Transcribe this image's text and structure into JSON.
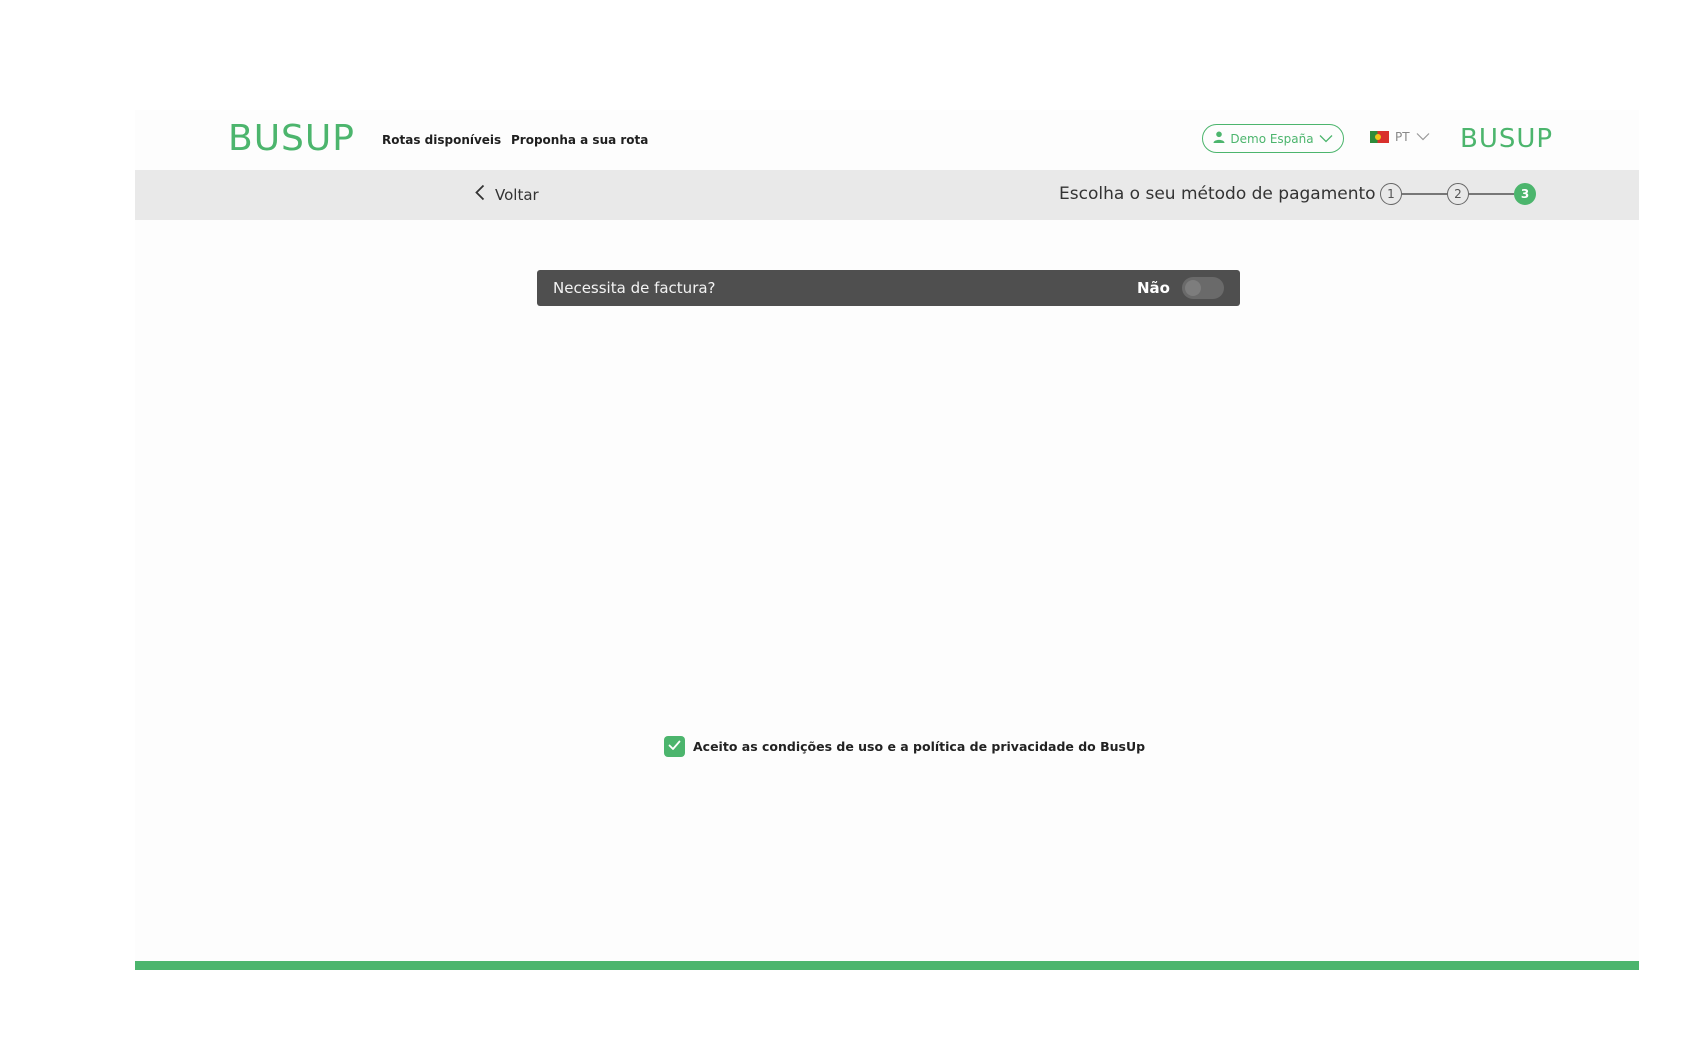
{
  "header": {
    "logo_left": "BUSUP",
    "logo_right": "BUSUP",
    "nav_links": [
      "Rotas disponíveis",
      "Proponha a sua rota"
    ],
    "user_menu_label": "Demo España",
    "language": "PT"
  },
  "stepbar": {
    "back_label": "Voltar",
    "title": "Escolha o seu método de pagamento",
    "steps": [
      "1",
      "2",
      "3"
    ],
    "active_step": 3
  },
  "invoice": {
    "question": "Necessita de factura?",
    "toggle_state_label": "Não",
    "toggle_on": false
  },
  "terms": {
    "label": "Aceito as condições de uso e a política de privacidade do BusUp",
    "checked": true
  },
  "colors": {
    "brand_green": "#4cb56d",
    "invoice_bar": "#4f4f4f",
    "stepbar_bg": "#e9e9e9"
  },
  "icons": [
    "user-icon",
    "chevron-down-icon",
    "flag-portugal-icon",
    "chevron-left-icon",
    "checkmark-icon"
  ]
}
